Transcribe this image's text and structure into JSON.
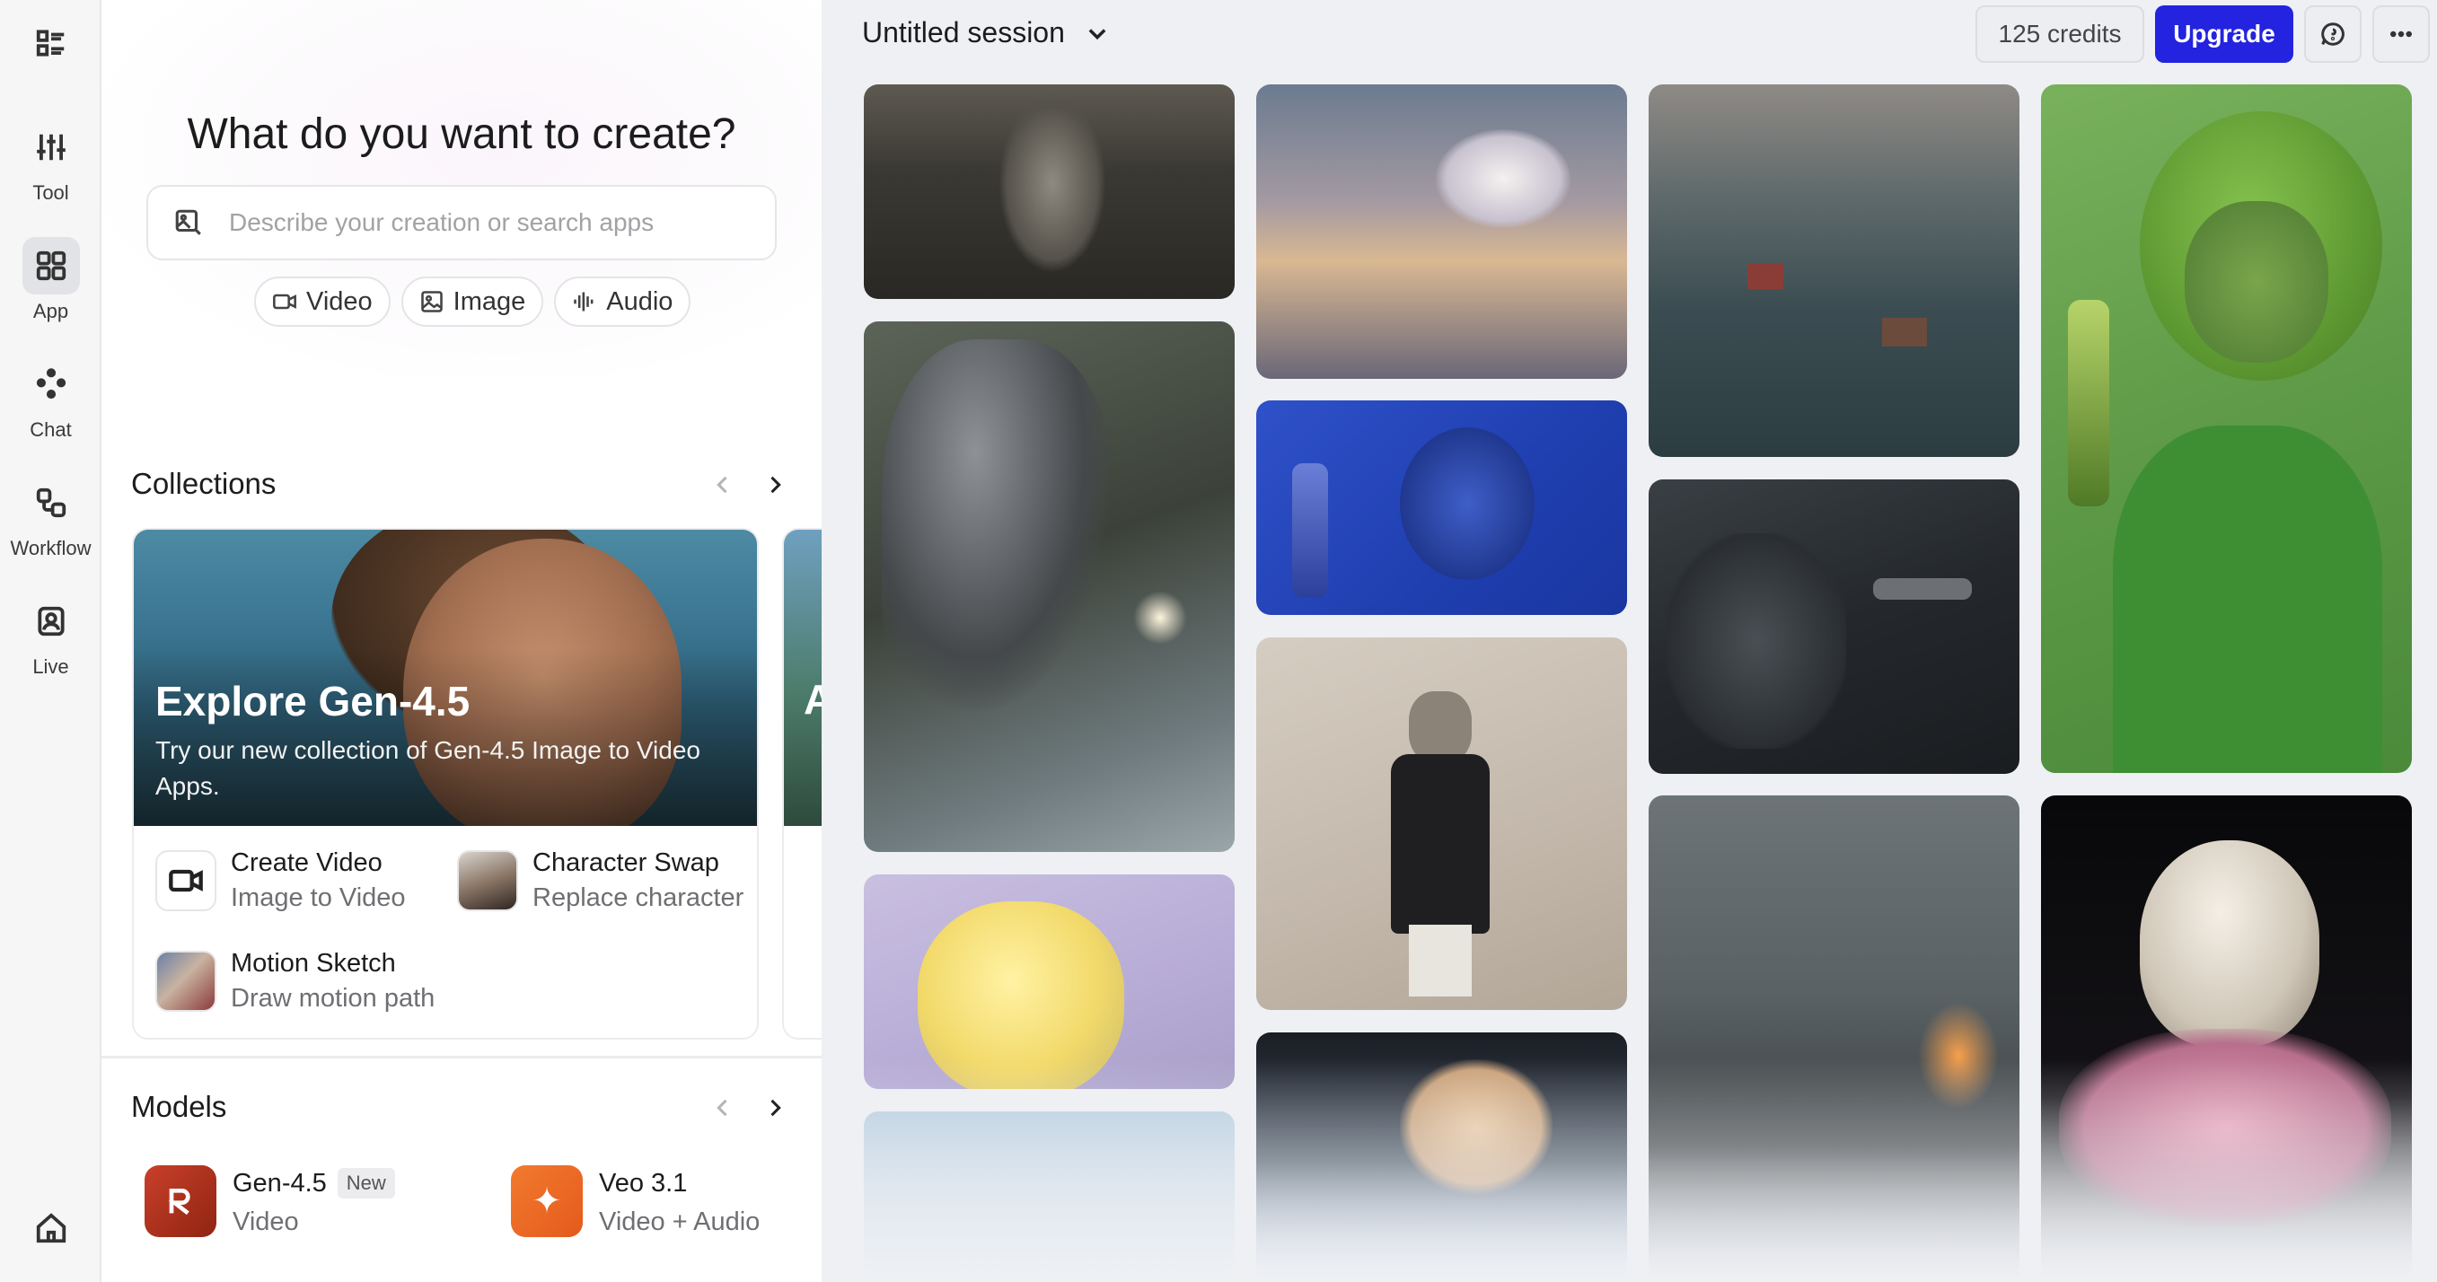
{
  "rail": {
    "items": [
      {
        "label": "",
        "icon": "list-icon"
      },
      {
        "label": "Tool",
        "icon": "sliders-icon"
      },
      {
        "label": "App",
        "icon": "grid-icon"
      },
      {
        "label": "Chat",
        "icon": "sparkle-dots-icon"
      },
      {
        "label": "Workflow",
        "icon": "workflow-icon"
      },
      {
        "label": "Live",
        "icon": "live-icon"
      }
    ],
    "home_icon": "home-icon"
  },
  "hero": {
    "title": "What do you want to create?",
    "search_placeholder": "Describe your creation or search apps",
    "chips": [
      "Video",
      "Image",
      "Audio"
    ]
  },
  "collections": {
    "title": "Collections",
    "card": {
      "title": "Explore Gen-4.5",
      "subtitle": "Try our new collection of Gen-4.5 Image to Video Apps.",
      "apps": [
        {
          "title": "Create Video",
          "subtitle": "Image to Video"
        },
        {
          "title": "Character Swap",
          "subtitle": "Replace character"
        },
        {
          "title": "Motion Sketch",
          "subtitle": "Draw motion path"
        }
      ]
    },
    "card2_letter": "A"
  },
  "models": {
    "title": "Models",
    "items": [
      {
        "name": "Gen-4.5",
        "badge": "New",
        "type": "Video",
        "logo_color": "#b2341d"
      },
      {
        "name": "Veo 3.1",
        "badge": "",
        "type": "Video + Audio",
        "logo_color": "#ef6a24"
      }
    ]
  },
  "header": {
    "session": "Untitled session",
    "credits": "125 credits",
    "upgrade": "Upgrade",
    "accent": "#2323e0"
  },
  "gallery_note": "Grid of generated media thumbnails"
}
